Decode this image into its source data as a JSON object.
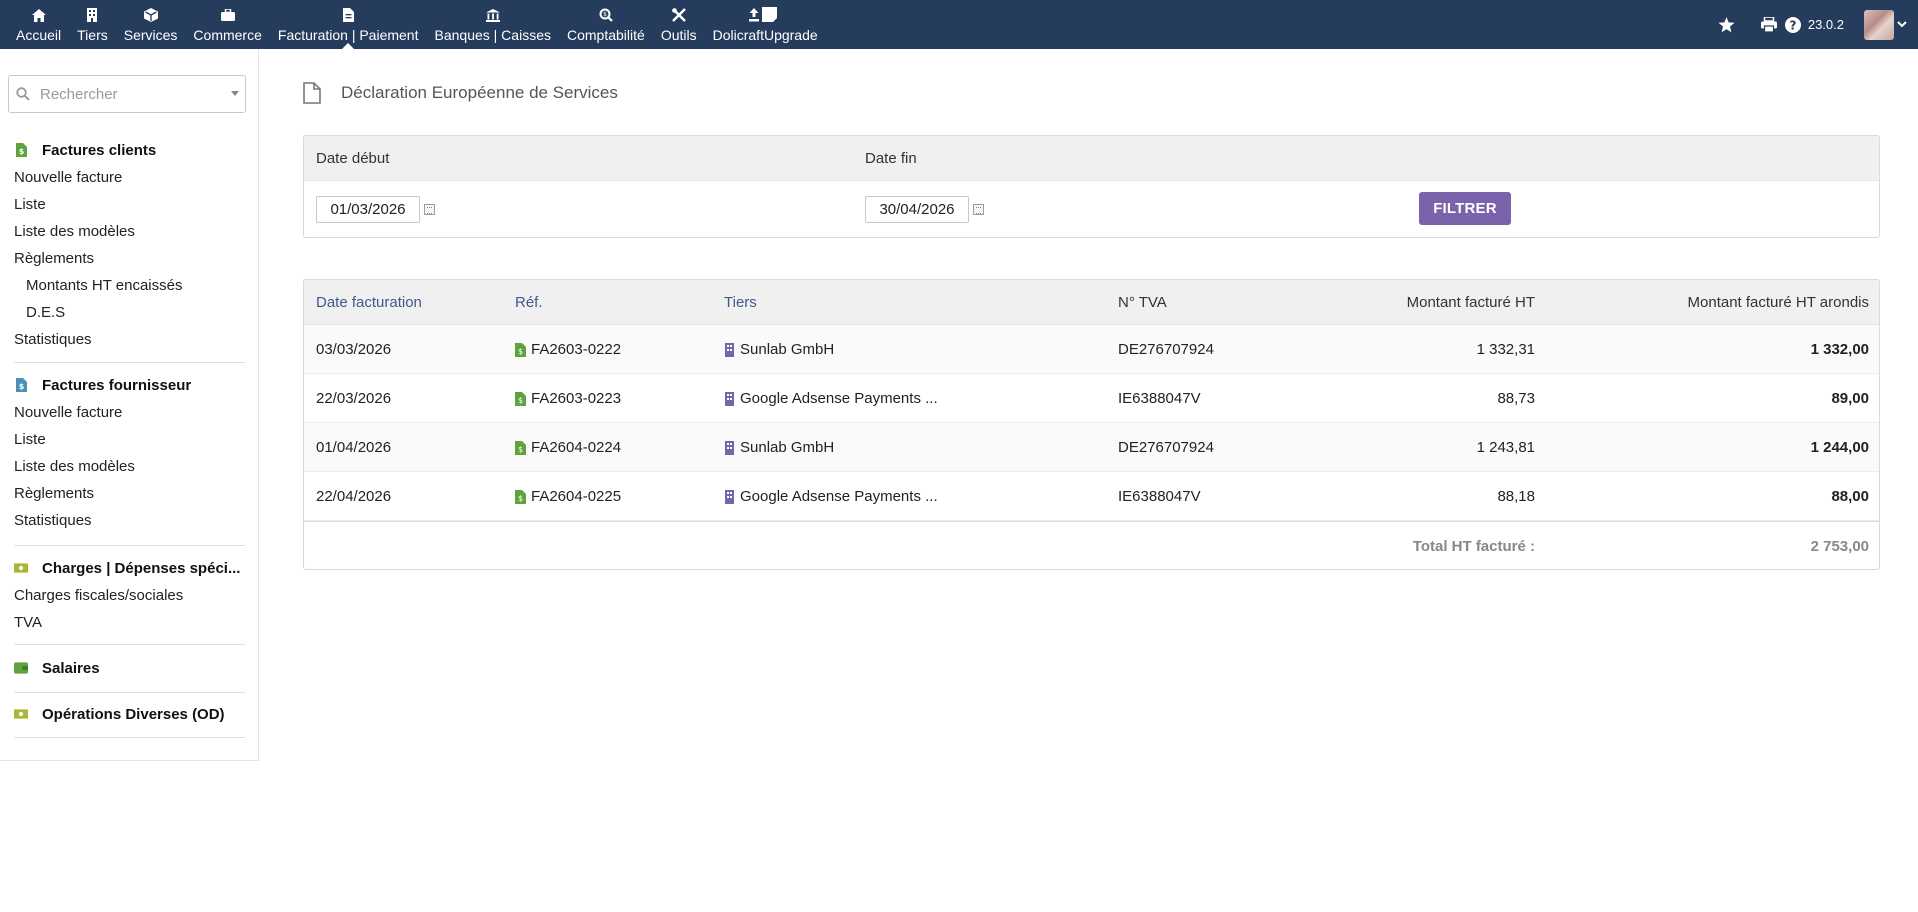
{
  "topmenu": [
    {
      "key": "home",
      "label": "Accueil",
      "icon": "home-icon"
    },
    {
      "key": "thirdparties",
      "label": "Tiers",
      "icon": "building-icon"
    },
    {
      "key": "services",
      "label": "Services",
      "icon": "cube-icon"
    },
    {
      "key": "commerce",
      "label": "Commerce",
      "icon": "briefcase-icon"
    },
    {
      "key": "billing",
      "label": "Facturation | Paiement",
      "icon": "invoice-icon"
    },
    {
      "key": "bank",
      "label": "Banques | Caisses",
      "icon": "bank-icon"
    },
    {
      "key": "accounting",
      "label": "Comptabilité",
      "icon": "search-dollar-icon"
    },
    {
      "key": "tools",
      "label": "Outils",
      "icon": "tools-icon"
    },
    {
      "key": "upgrade",
      "label": "DolicraftUpgrade",
      "icon": "upload-icon"
    }
  ],
  "topright": {
    "version": "23.0.2"
  },
  "search": {
    "placeholder": "Rechercher"
  },
  "leftmenu": {
    "customer_invoices": {
      "title": "Factures clients",
      "items": [
        "Nouvelle facture",
        "Liste",
        "Liste des modèles",
        "Règlements"
      ],
      "sub_items": [
        "Montants HT encaissés",
        "D.E.S"
      ],
      "last": "Statistiques"
    },
    "supplier_invoices": {
      "title": "Factures fournisseur",
      "items": [
        "Nouvelle facture",
        "Liste",
        "Liste des modèles",
        "Règlements",
        "Statistiques"
      ]
    },
    "charges": {
      "title": "Charges | Dépenses spéci...",
      "items": [
        "Charges fiscales/sociales",
        "TVA"
      ]
    },
    "salaries": {
      "title": "Salaires"
    },
    "od": {
      "title": "Opérations Diverses (OD)"
    }
  },
  "page": {
    "title": "Déclaration Européenne de Services"
  },
  "filter": {
    "date_start_label": "Date début",
    "date_end_label": "Date fin",
    "date_start": "01/03/2026",
    "date_end": "30/04/2026",
    "button": "FILTRER"
  },
  "table": {
    "headers": {
      "date": "Date facturation",
      "ref": "Réf.",
      "thirdparty": "Tiers",
      "vat": "N° TVA",
      "amount": "Montant facturé HT",
      "amount_rounded": "Montant facturé HT arondis"
    },
    "rows": [
      {
        "date": "03/03/2026",
        "ref": "FA2603-0222",
        "thirdparty": "Sunlab GmbH",
        "vat": "DE276707924",
        "amount": "1 332,31",
        "amount_rounded": "1 332,00"
      },
      {
        "date": "22/03/2026",
        "ref": "FA2603-0223",
        "thirdparty": "Google Adsense Payments ...",
        "vat": "IE6388047V",
        "amount": "88,73",
        "amount_rounded": "89,00"
      },
      {
        "date": "01/04/2026",
        "ref": "FA2604-0224",
        "thirdparty": "Sunlab GmbH",
        "vat": "DE276707924",
        "amount": "1 243,81",
        "amount_rounded": "1 244,00"
      },
      {
        "date": "22/04/2026",
        "ref": "FA2604-0225",
        "thirdparty": "Google Adsense Payments ...",
        "vat": "IE6388047V",
        "amount": "88,18",
        "amount_rounded": "88,00"
      }
    ],
    "total_label": "Total HT facturé :",
    "total_value": "2 753,00"
  },
  "colors": {
    "topbar": "#263c5c",
    "button": "#7b63ab",
    "link": "#263c7c",
    "invoice_icon": "#5ea33e",
    "thirdparty_icon": "#6c6aa8"
  }
}
